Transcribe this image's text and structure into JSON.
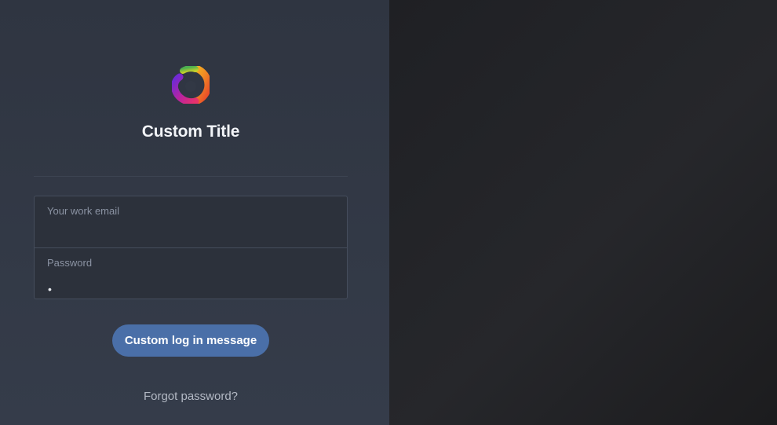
{
  "app": {
    "title": "Custom Title"
  },
  "login_form": {
    "email": {
      "label": "Your work email",
      "value": "",
      "placeholder": ""
    },
    "password": {
      "label": "Password",
      "value": "•"
    },
    "submit_label": "Custom log in message",
    "forgot_label": "Forgot password?"
  },
  "theme": {
    "accent": "#4a6fa8",
    "panel_bg": "#323845",
    "right_bg": "#222326"
  },
  "icons": {
    "logo": "colorful-swirl-logo-icon"
  }
}
